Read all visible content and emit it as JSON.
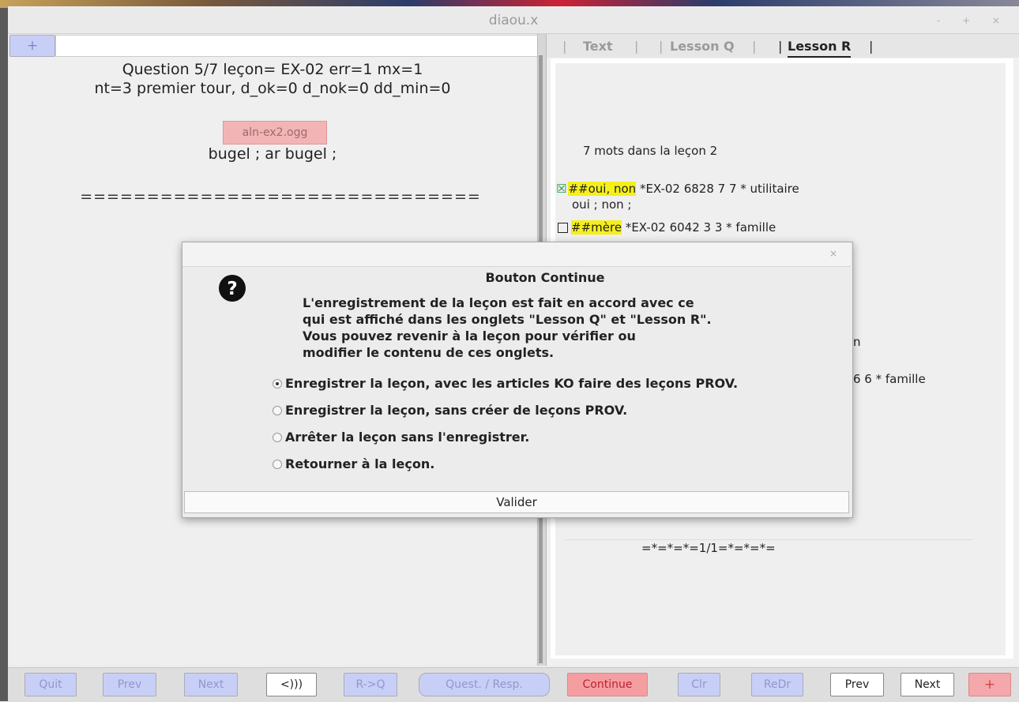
{
  "window": {
    "title": "diaou.x",
    "controls": "- + ×"
  },
  "left": {
    "plus_label": "+",
    "question_line1": "Question  5/7   leçon= EX-02   err=1   mx=1",
    "question_line2": "nt=3 premier tour,  d_ok=0  d_nok=0  dd_min=0",
    "audio_file": "aln-ex2.ogg",
    "answer": "bugel ; ar bugel ;",
    "separator": "=============================="
  },
  "right": {
    "tabs": [
      {
        "label": "Text",
        "active": false
      },
      {
        "label": "Lesson Q",
        "active": false
      },
      {
        "label": "Lesson R",
        "active": true
      }
    ],
    "tab_seps": [
      "|",
      "|",
      "|",
      "|",
      "|"
    ],
    "words_count": "7  mots dans la leçon  2",
    "entries": [
      {
        "checked": true,
        "head": "##oui, non",
        "rest": " *EX-02 6828 7  7 * utilitaire",
        "sub": "oui ; non ;"
      },
      {
        "checked": false,
        "head": "##mère",
        "rest": " *EX-02 6042 3  3 * famille",
        "sub": ""
      }
    ],
    "partial_n": "n",
    "partial_family": "6  6 * famille",
    "footer_marker": "=*=*=*=1/1=*=*=*="
  },
  "bottom_left": {
    "quit": "Quit",
    "prev": "Prev",
    "next": "Next",
    "audio": "<)))",
    "rq": "R->Q",
    "quest_resp": "Quest. / Resp."
  },
  "bottom_right": {
    "continue": "Continue",
    "clr": "Clr",
    "redr": "ReDr",
    "prev": "Prev",
    "next": "Next",
    "plus": "+"
  },
  "dialog": {
    "close": "×",
    "heading": "Bouton Continue",
    "message_lines": [
      "L'enregistrement de la leçon est fait en accord avec ce",
      "qui est affiché dans les onglets  \"Lesson Q\" et \"Lesson R\".",
      "Vous pouvez revenir à la leçon pour vérifier ou",
      "modifier le contenu de ces onglets."
    ],
    "options": [
      {
        "label": "Enregistrer la leçon, avec les articles KO faire des leçons PROV.",
        "selected": true
      },
      {
        "label": "Enregistrer la leçon, sans créer de leçons PROV.",
        "selected": false
      },
      {
        "label": "Arrêter la leçon sans l'enregistrer.",
        "selected": false
      },
      {
        "label": "Retourner à la leçon.",
        "selected": false
      }
    ],
    "validate_label": "Valider"
  },
  "colors": {
    "highlight": "#f5ef1c",
    "blue_button": "#c8cff7",
    "red_button": "#f59ea1",
    "check_green": "#1d9b3a"
  }
}
